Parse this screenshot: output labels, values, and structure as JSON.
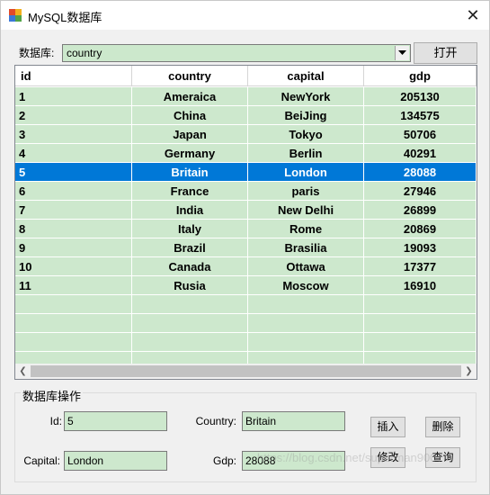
{
  "window": {
    "title": "MySQL数据库",
    "close_symbol": "✕"
  },
  "db_selector": {
    "label": "数据库:",
    "value": "country",
    "open_button": "打开"
  },
  "table": {
    "columns": [
      "id",
      "country",
      "capital",
      "gdp"
    ],
    "selected_row": 4,
    "rows": [
      [
        "1",
        "Ameraica",
        "NewYork",
        "205130"
      ],
      [
        "2",
        "China",
        "BeiJing",
        "134575"
      ],
      [
        "3",
        "Japan",
        "Tokyo",
        "50706"
      ],
      [
        "4",
        "Germany",
        "Berlin",
        "40291"
      ],
      [
        "5",
        "Britain",
        "London",
        "28088"
      ],
      [
        "6",
        "France",
        "paris",
        "27946"
      ],
      [
        "7",
        "India",
        "New Delhi",
        "26899"
      ],
      [
        "8",
        "Italy",
        "Rome",
        "20869"
      ],
      [
        "9",
        "Brazil",
        "Brasilia",
        "19093"
      ],
      [
        "10",
        "Canada",
        "Ottawa",
        "17377"
      ],
      [
        "11",
        "Rusia",
        "Moscow",
        "16910"
      ]
    ]
  },
  "operations": {
    "group_title": "数据库操作",
    "id_label": "Id:",
    "id_value": "5",
    "country_label": "Country:",
    "country_value": "Britain",
    "capital_label": "Capital:",
    "capital_value": "London",
    "gdp_label": "Gdp:",
    "gdp_value": "28088",
    "insert_button": "插入",
    "delete_button": "删除",
    "modify_button": "修改",
    "query_button": "查询"
  },
  "watermark": "https://blog.csdn.net/superman9007",
  "colors": {
    "grid_background": "#cde8cd",
    "selection": "#0078d7"
  }
}
